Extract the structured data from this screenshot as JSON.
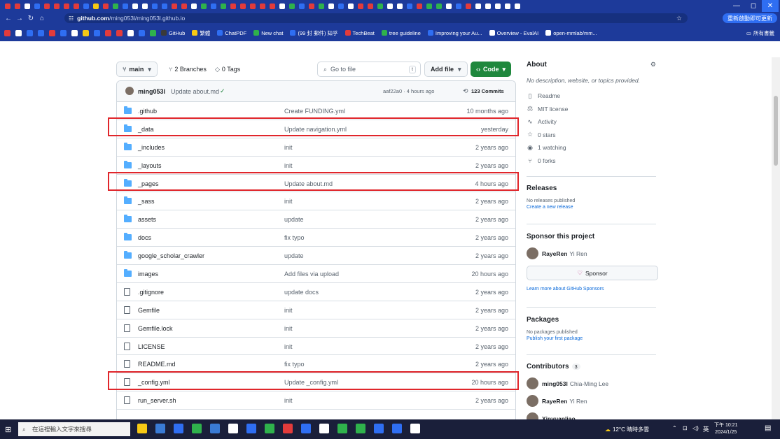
{
  "browser": {
    "url_host": "github.com",
    "url_path": "/ming053l/ming053l.github.io",
    "update_chip": "重新啟動即可更新",
    "bookmarks": [
      "GitHub",
      "繁體",
      "ChatPDF",
      "New chat",
      "(99 封 郵件) 知乎",
      "TechBeat",
      "tree guideline",
      "Improving your Au...",
      "Overview - EvalAI",
      "open-mmlab/mm..."
    ],
    "all_bookmarks": "所有書籤",
    "favicon_colors": [
      "#e23b3b",
      "#e23b3b",
      "#ffffff",
      "#2f6ef2",
      "#e23b3b",
      "#e23b3b",
      "#e23b3b",
      "#e23b3b",
      "#2f6ef2",
      "#f6c915",
      "#e23b3b",
      "#2fb24c",
      "#2f6ef2",
      "#ffffff",
      "#ffffff",
      "#2f6ef2",
      "#2f6ef2",
      "#e23b3b",
      "#e23b3b",
      "#ffffff",
      "#2fb24c",
      "#2f6ef2",
      "#2fb24c",
      "#e23b3b",
      "#e23b3b",
      "#e23b3b",
      "#e23b3b",
      "#e23b3b",
      "#ffffff",
      "#2fb24c",
      "#2f6ef2",
      "#e23b3b",
      "#2fb24c",
      "#ffffff",
      "#2f6ef2",
      "#ffffff",
      "#e23b3b",
      "#e23b3b",
      "#2fb24c",
      "#ffffff",
      "#ffffff",
      "#2f6ef2",
      "#e23b3b",
      "#2fb24c",
      "#2fb24c",
      "#ffffff",
      "#2f6ef2",
      "#e23b3b",
      "#ffffff",
      "#ffffff",
      "#ffffff",
      "#ffffff",
      "#ffffff"
    ]
  },
  "repo": {
    "branch": "main",
    "branches": "2 Branches",
    "tags": "0 Tags",
    "goto_placeholder": "Go to file",
    "goto_kbd": "t",
    "add_file": "Add file",
    "code": "Code"
  },
  "commit": {
    "author": "ming053l",
    "message": "Update about.md",
    "meta": "aaf22a0 · 4 hours ago",
    "count": "123 Commits"
  },
  "files": [
    {
      "name": ".github",
      "type": "folder",
      "message": "Create FUNDING.yml",
      "time": "10 months ago"
    },
    {
      "name": "_data",
      "type": "folder",
      "message": "Update navigation.yml",
      "time": "yesterday"
    },
    {
      "name": "_includes",
      "type": "folder",
      "message": "init",
      "time": "2 years ago"
    },
    {
      "name": "_layouts",
      "type": "folder",
      "message": "init",
      "time": "2 years ago"
    },
    {
      "name": "_pages",
      "type": "folder",
      "message": "Update about.md",
      "time": "4 hours ago"
    },
    {
      "name": "_sass",
      "type": "folder",
      "message": "init",
      "time": "2 years ago"
    },
    {
      "name": "assets",
      "type": "folder",
      "message": "update",
      "time": "2 years ago"
    },
    {
      "name": "docs",
      "type": "folder",
      "message": "fix typo",
      "time": "2 years ago"
    },
    {
      "name": "google_scholar_crawler",
      "type": "folder",
      "message": "update",
      "time": "2 years ago"
    },
    {
      "name": "images",
      "type": "folder",
      "message": "Add files via upload",
      "time": "20 hours ago"
    },
    {
      "name": ".gitignore",
      "type": "file",
      "message": "update docs",
      "time": "2 years ago"
    },
    {
      "name": "Gemfile",
      "type": "file",
      "message": "init",
      "time": "2 years ago"
    },
    {
      "name": "Gemfile.lock",
      "type": "file",
      "message": "init",
      "time": "2 years ago"
    },
    {
      "name": "LICENSE",
      "type": "file",
      "message": "init",
      "time": "2 years ago"
    },
    {
      "name": "README.md",
      "type": "file",
      "message": "fix typo",
      "time": "2 years ago"
    },
    {
      "name": "_config.yml",
      "type": "file",
      "message": "Update _config.yml",
      "time": "20 hours ago"
    },
    {
      "name": "run_server.sh",
      "type": "file",
      "message": "init",
      "time": "2 years ago"
    }
  ],
  "highlighted_rows": [
    "_data",
    "_pages",
    "_config.yml"
  ],
  "about": {
    "title": "About",
    "description": "No description, website, or topics provided.",
    "readme": "Readme",
    "license": "MIT license",
    "activity": "Activity",
    "stars": "0 stars",
    "watching": "1 watching",
    "forks": "0 forks"
  },
  "releases": {
    "title": "Releases",
    "none": "No releases published",
    "create": "Create a new release"
  },
  "sponsor": {
    "title": "Sponsor this project",
    "user": "RayeRen",
    "user_name": "Yi Ren",
    "button": "Sponsor",
    "learn": "Learn more about GitHub Sponsors"
  },
  "packages": {
    "title": "Packages",
    "none": "No packages published",
    "publish": "Publish your first package"
  },
  "contributors": {
    "title": "Contributors",
    "count": "3",
    "list": [
      {
        "login": "ming053l",
        "name": "Chia-Ming Lee"
      },
      {
        "login": "RayeRen",
        "name": "Yi Ren"
      },
      {
        "login": "Xinyuanliao",
        "name": ""
      }
    ]
  },
  "taskbar": {
    "search": "在這裡輸入文字來搜尋",
    "weather": "12°C 晴時多雲",
    "ime": "英",
    "time": "下午 10:21",
    "date": "2024/1/25"
  }
}
